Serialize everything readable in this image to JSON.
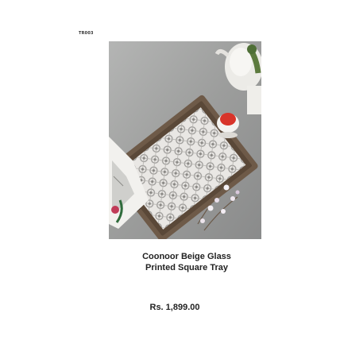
{
  "product": {
    "sku": "TR003",
    "title_line1": "Coonoor Beige Glass",
    "title_line2": "Printed Square Tray",
    "price": "Rs. 1,899.00"
  },
  "colors": {
    "background": "#ffffff",
    "text": "#222222",
    "backdrop": "#9a9b9b",
    "tray_frame": "#6e5a48",
    "accent_red": "#d8342a"
  }
}
